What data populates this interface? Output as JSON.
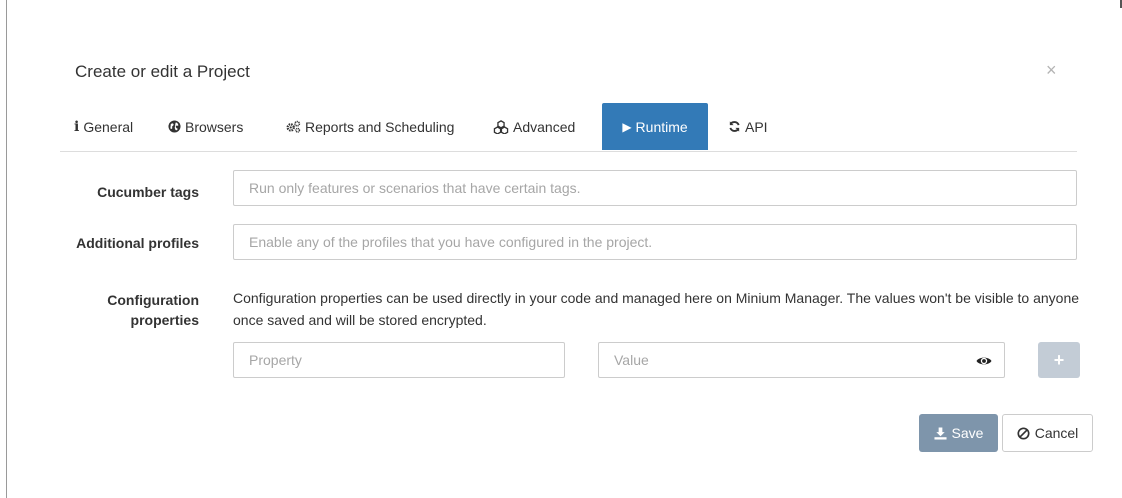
{
  "modal": {
    "title": "Create or edit a Project",
    "close_glyph": "×"
  },
  "tabs": [
    {
      "label": "General",
      "icon": "info-icon",
      "glyph": "i",
      "active": false
    },
    {
      "label": "Browsers",
      "icon": "globe-icon",
      "glyph": "",
      "active": false
    },
    {
      "label": "Reports and Scheduling",
      "icon": "cogs-icon",
      "glyph": "",
      "active": false
    },
    {
      "label": "Advanced",
      "icon": "cubes-icon",
      "glyph": "",
      "active": false
    },
    {
      "label": "Runtime",
      "icon": "play-icon",
      "glyph": "▶",
      "active": true
    },
    {
      "label": "API",
      "icon": "refresh-icon",
      "glyph": "",
      "active": false
    }
  ],
  "form": {
    "cucumber_tags": {
      "label": "Cucumber tags",
      "placeholder": "Run only features or scenarios that have certain tags.",
      "value": ""
    },
    "additional_profiles": {
      "label": "Additional profiles",
      "placeholder": "Enable any of the profiles that you have configured in the project.",
      "value": ""
    },
    "configuration_properties": {
      "label_line1": "Configuration",
      "label_line2": "properties",
      "help": "Configuration properties can be used directly in your code and managed here on Minium Manager. The values won't be visible to anyone once saved and will be stored encrypted.",
      "property_placeholder": "Property",
      "value_placeholder": "Value",
      "add_glyph": "+"
    }
  },
  "footer": {
    "save_label": "Save",
    "cancel_label": "Cancel"
  },
  "colors": {
    "primary": "#337ab7",
    "save_button": "#7e95ab",
    "add_button_disabled": "#c3ccd6",
    "placeholder": "#a6a6a6"
  }
}
